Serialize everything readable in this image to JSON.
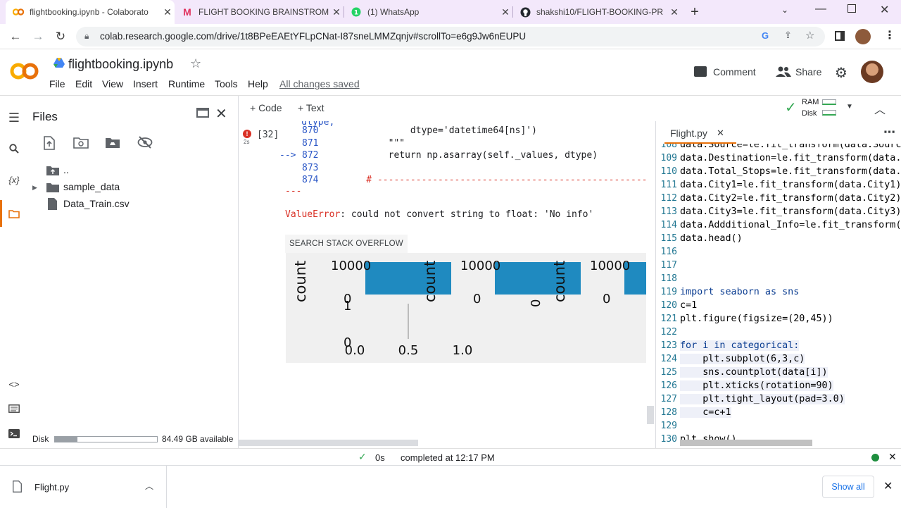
{
  "browser": {
    "tabs": [
      {
        "title": "flightbooking.ipynb - Colaborato",
        "favicon": "colab-icon"
      },
      {
        "title": "FLIGHT BOOKING BRAINSTROM",
        "favicon": "miro-icon"
      },
      {
        "title": "(1) WhatsApp",
        "favicon": "whatsapp-icon"
      },
      {
        "title": "shakshi10/FLIGHT-BOOKING-PR",
        "favicon": "github-icon"
      }
    ],
    "url": "colab.research.google.com/drive/1t8BPeEAEtYFLpCNat-I87sneLMMZqnjv#scrollTo=e6g9Jw6nEUPU"
  },
  "colab": {
    "logo_text": "CO",
    "notebook_title": "flightbooking.ipynb",
    "menu": [
      "File",
      "Edit",
      "View",
      "Insert",
      "Runtime",
      "Tools",
      "Help"
    ],
    "save_status": "All changes saved",
    "comment_label": "Comment",
    "share_label": "Share"
  },
  "files_panel": {
    "title": "Files",
    "tree": [
      {
        "name": "..",
        "type": "folder-up"
      },
      {
        "name": "sample_data",
        "type": "folder"
      },
      {
        "name": "Data_Train.csv",
        "type": "file"
      }
    ],
    "disk_label": "Disk",
    "disk_available": "84.49 GB available",
    "disk_used_fraction": 0.22
  },
  "notebook": {
    "add_code": "+ Code",
    "add_text": "+ Text",
    "ram_label": "RAM",
    "disk_label": "Disk",
    "cell_exec_count": "[32]",
    "cell_exec_time": "2s",
    "traceback": [
      {
        "num": "870",
        "arrow": "",
        "code": "            dtype='datetime64[ns]')"
      },
      {
        "num": "871",
        "arrow": "",
        "code": "        \"\"\""
      },
      {
        "num": "872",
        "arrow": "-->",
        "code": "        return np.asarray(self._values, dtype)"
      },
      {
        "num": "873",
        "arrow": "",
        "code": ""
      },
      {
        "num": "874",
        "arrow": "",
        "code": "    # -------------------------------------------------------"
      }
    ],
    "traceback_sep": "---",
    "error_type": "ValueError",
    "error_msg": ": could not convert string to float: 'No info'",
    "so_button": "SEARCH STACK OVERFLOW",
    "plot_labels": {
      "count": "count",
      "y_top": "10000",
      "y_zero": "0",
      "stray_one": "1",
      "stray_zero": "0",
      "x_ticks": [
        "0.0",
        "0.5",
        "1.0"
      ]
    },
    "bar_color": "#1f8ac0"
  },
  "editor": {
    "filename": "Flight.py",
    "lines": [
      {
        "n": "108",
        "t": "data.Source=le.fit_transform(data.Source)"
      },
      {
        "n": "109",
        "t": "data.Destination=le.fit_transform(data.De"
      },
      {
        "n": "110",
        "t": "data.Total_Stops=le.fit_transform(data.To"
      },
      {
        "n": "111",
        "t": "data.City1=le.fit_transform(data.City1)"
      },
      {
        "n": "112",
        "t": "data.City2=le.fit_transform(data.City2)"
      },
      {
        "n": "113",
        "t": "data.City3=le.fit_transform(data.City3)"
      },
      {
        "n": "114",
        "t": "data.Addditional_Info=le.fit_transform(da"
      },
      {
        "n": "115",
        "t": "data.head()"
      },
      {
        "n": "116",
        "t": ""
      },
      {
        "n": "117",
        "t": ""
      },
      {
        "n": "118",
        "t": ""
      },
      {
        "n": "119",
        "t": "import seaborn as sns"
      },
      {
        "n": "120",
        "t": "c=1"
      },
      {
        "n": "121",
        "t": "plt.figure(figsize=(20,45))"
      },
      {
        "n": "122",
        "t": ""
      },
      {
        "n": "123",
        "t": "for i in categorical:"
      },
      {
        "n": "124",
        "t": "    plt.subplot(6,3,c)"
      },
      {
        "n": "125",
        "t": "    sns.countplot(data[i])"
      },
      {
        "n": "126",
        "t": "    plt.xticks(rotation=90)"
      },
      {
        "n": "127",
        "t": "    plt.tight_layout(pad=3.0)"
      },
      {
        "n": "128",
        "t": "    c=c+1"
      },
      {
        "n": "129",
        "t": ""
      },
      {
        "n": "130",
        "t": "plt.show()"
      }
    ]
  },
  "status_bar": {
    "duration": "0s",
    "completed": "completed at 12:17 PM"
  },
  "download_bar": {
    "filename": "Flight.py",
    "show_all": "Show all"
  }
}
